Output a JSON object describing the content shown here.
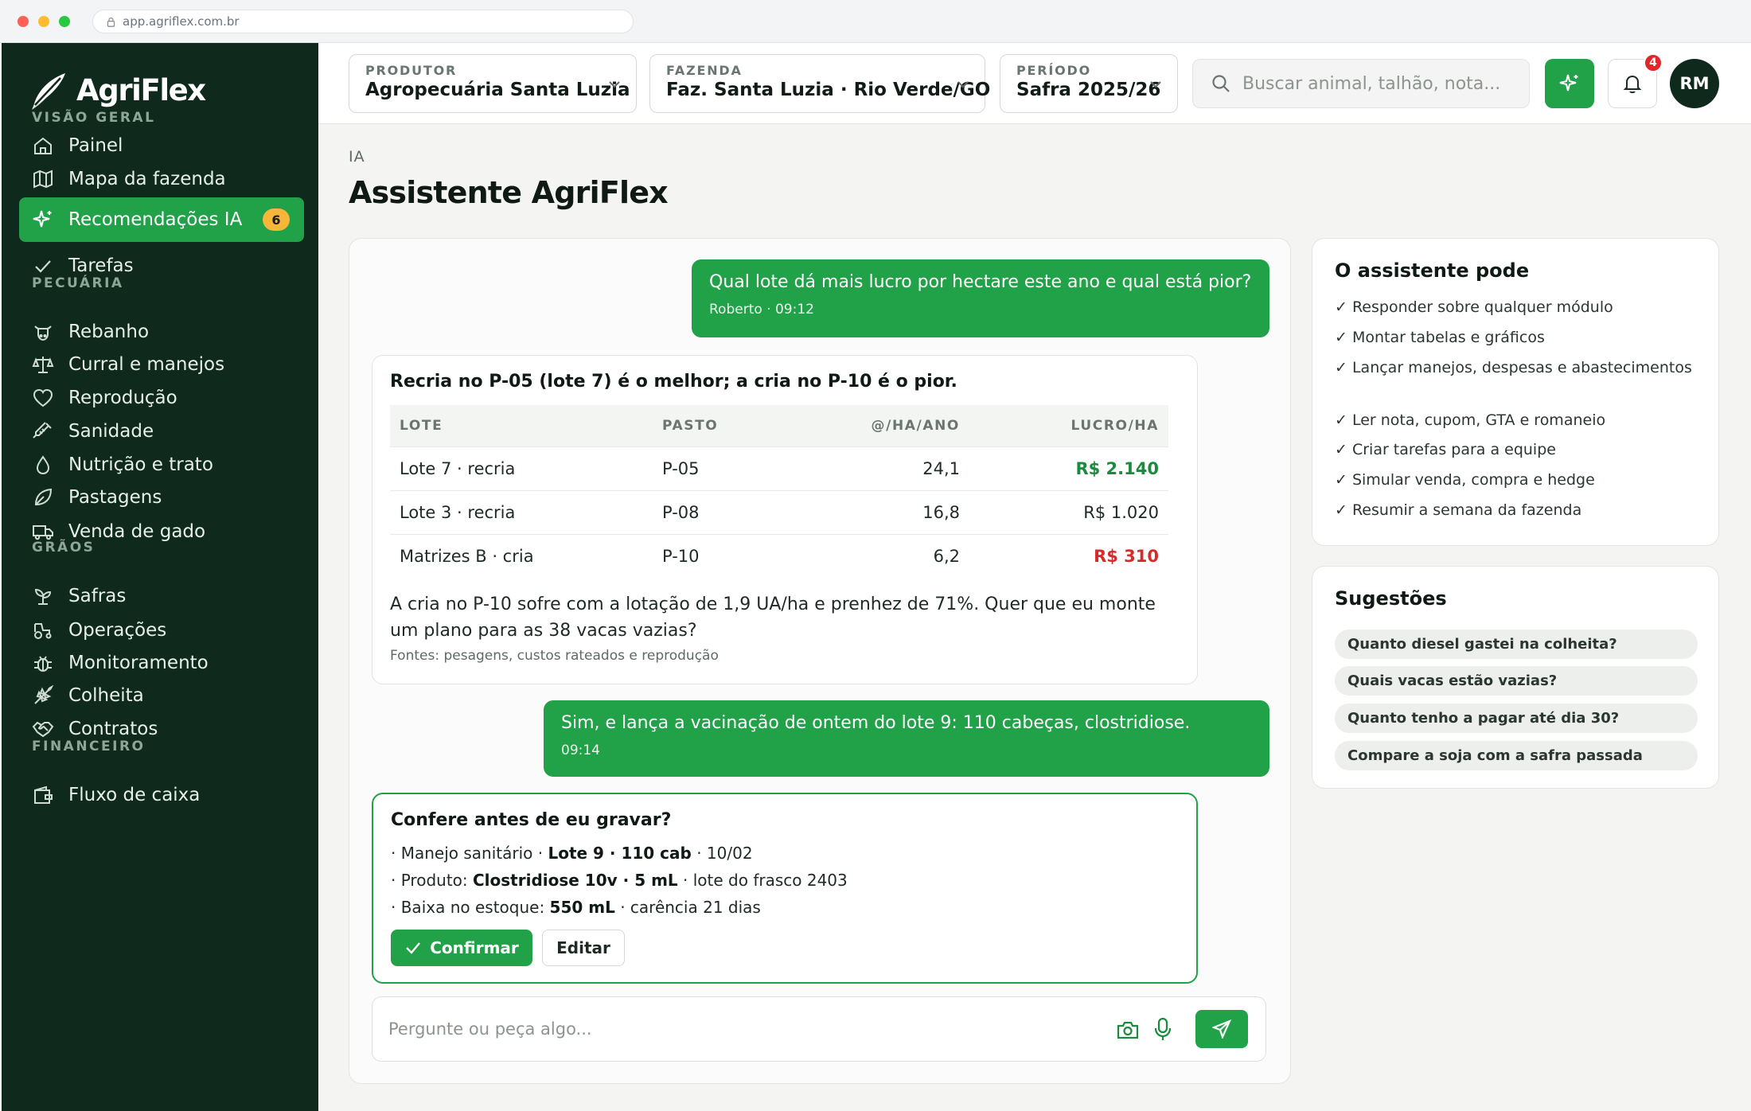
{
  "browser": {
    "url": "app.agriflex.com.br"
  },
  "brand": {
    "name": "AgriFlex",
    "accent": "#21a148",
    "sidebar_bg": "#0f2a1c"
  },
  "sidebar": {
    "sections": [
      {
        "title": "VISÃO GERAL"
      },
      {
        "title": "PECUÁRIA"
      },
      {
        "title": "GRÃOS"
      },
      {
        "title": "FINANCEIRO"
      }
    ],
    "items": [
      {
        "label": "Painel",
        "icon": "home-icon"
      },
      {
        "label": "Mapa da fazenda",
        "icon": "map-icon"
      },
      {
        "label": "Recomendações IA",
        "icon": "sparkle-icon",
        "badge": "6",
        "active": true
      },
      {
        "label": "Tarefas",
        "icon": "check-icon"
      },
      {
        "label": "Rebanho",
        "icon": "cow-icon"
      },
      {
        "label": "Curral e manejos",
        "icon": "scale-icon"
      },
      {
        "label": "Reprodução",
        "icon": "heart-icon"
      },
      {
        "label": "Sanidade",
        "icon": "syringe-icon"
      },
      {
        "label": "Nutrição e trato",
        "icon": "drop-icon"
      },
      {
        "label": "Pastagens",
        "icon": "leaf-icon"
      },
      {
        "label": "Venda de gado",
        "icon": "truck-icon"
      },
      {
        "label": "Safras",
        "icon": "sprout-icon"
      },
      {
        "label": "Operações",
        "icon": "tractor-icon"
      },
      {
        "label": "Monitoramento",
        "icon": "bug-icon"
      },
      {
        "label": "Colheita",
        "icon": "wheat-icon"
      },
      {
        "label": "Contratos",
        "icon": "handshake-icon"
      },
      {
        "label": "Fluxo de caixa",
        "icon": "wallet-icon"
      }
    ]
  },
  "topbar": {
    "produtor": {
      "label": "PRODUTOR",
      "value": "Agropecuária Santa Luzia"
    },
    "fazenda": {
      "label": "FAZENDA",
      "value": "Faz. Santa Luzia · Rio Verde/GO"
    },
    "periodo": {
      "label": "PERÍODO",
      "value": "Safra 2025/26"
    },
    "search_placeholder": "Buscar animal, talhão, nota...",
    "notifications": "4",
    "avatar": "RM"
  },
  "page": {
    "breadcrumb": "IA",
    "title": "Assistente AgriFlex"
  },
  "chat": {
    "msg1": {
      "text": "Qual lote dá mais lucro por hectare este ano e qual está pior?",
      "meta": "Roberto · 09:12"
    },
    "answer": {
      "title": "Recria no P-05 (lote 7) é o melhor; a cria no P-10 é o pior.",
      "columns": [
        "LOTE",
        "PASTO",
        "@/HA/ANO",
        "LUCRO/HA"
      ],
      "rows": [
        {
          "lote": "Lote 7 · recria",
          "pasto": "P-05",
          "arroba": "24,1",
          "lucro": "R$ 2.140",
          "status": "pos"
        },
        {
          "lote": "Lote 3 · recria",
          "pasto": "P-08",
          "arroba": "16,8",
          "lucro": "R$ 1.020",
          "status": "neutral"
        },
        {
          "lote": "Matrizes B · cria",
          "pasto": "P-10",
          "arroba": "6,2",
          "lucro": "R$ 310",
          "status": "neg"
        }
      ],
      "text": "A cria no P-10 sofre com a lotação de 1,9 UA/ha e prenhez de 71%. Quer que eu monte um plano para as 38 vacas vazias?",
      "sources": "Fontes: pesagens, custos rateados e reprodução"
    },
    "msg2": {
      "text": "Sim, e lança a vacinação de ontem do lote 9: 110 cabeças, clostridiose.",
      "meta": "09:14"
    },
    "confirm": {
      "title": "Confere antes de eu gravar?",
      "l1_a": "· Manejo sanitário · ",
      "l1_b": "Lote 9 · 110 cab",
      "l1_c": " · 10/02",
      "l2_a": "· Produto: ",
      "l2_b": "Clostridiose 10v · 5 mL",
      "l2_c": " · lote do frasco 2403",
      "l3_a": "· Baixa no estoque: ",
      "l3_b": "550 mL",
      "l3_c": " · carência 21 dias",
      "confirm_label": "Confirmar",
      "edit_label": "Editar"
    },
    "composer_placeholder": "Pergunte ou peça algo..."
  },
  "capabilities": {
    "title": "O assistente pode",
    "items": [
      "✓ Responder sobre qualquer módulo",
      "✓ Montar tabelas e gráficos",
      "✓ Lançar manejos, despesas e abastecimentos",
      "✓ Ler nota, cupom, GTA e romaneio",
      "✓ Criar tarefas para a equipe",
      "✓ Simular venda, compra e hedge",
      "✓ Resumir a semana da fazenda"
    ]
  },
  "suggestions": {
    "title": "Sugestões",
    "items": [
      "Quanto diesel gastei na colheita?",
      "Quais vacas estão vazias?",
      "Quanto tenho a pagar até dia 30?",
      "Compare a soja com a safra passada"
    ]
  }
}
